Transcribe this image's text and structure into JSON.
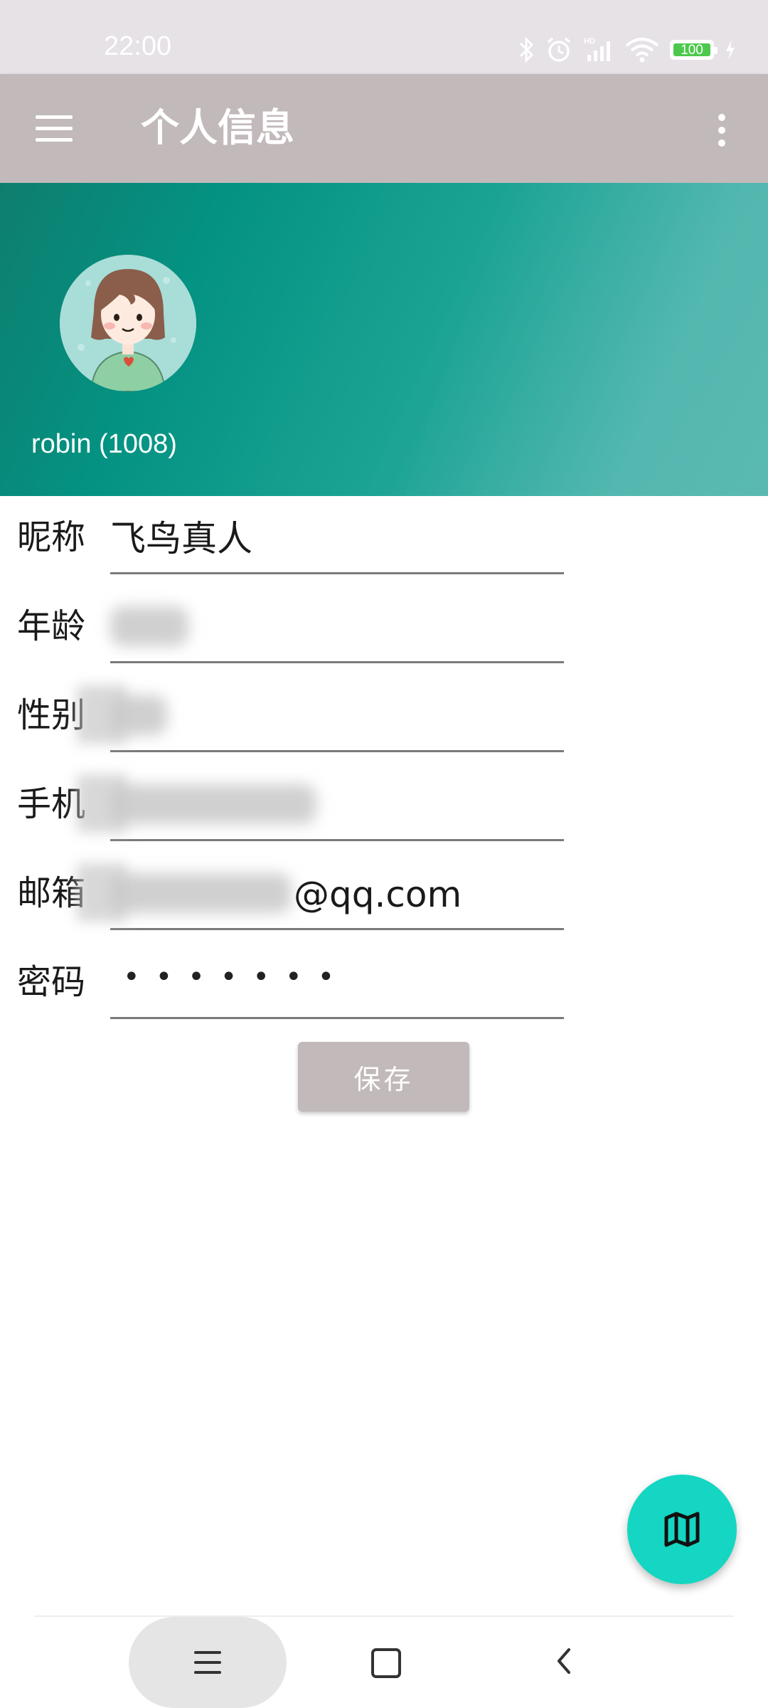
{
  "status_bar": {
    "time": "22:00",
    "icons": [
      "bluetooth-icon",
      "alarm-icon",
      "hd-signal-icon",
      "wifi-icon",
      "battery-icon",
      "charging-icon"
    ],
    "battery": "100"
  },
  "app_bar": {
    "title": "个人信息",
    "menu_icon": "hamburger-menu-icon",
    "more_icon": "more-vert-icon",
    "color": "#c2b9ba"
  },
  "profile": {
    "avatar": "avatar-cartoon-girl",
    "username": "robin (1008)"
  },
  "form": {
    "fields": [
      {
        "label": "昵称",
        "value": "飞鸟真人"
      },
      {
        "label": "年龄",
        "value": ""
      },
      {
        "label": "性别",
        "value": ""
      },
      {
        "label": "手机",
        "value": ""
      },
      {
        "label": "邮箱",
        "value": "@qq.com"
      },
      {
        "label": "密码",
        "value": "•••••••"
      }
    ],
    "save_label": "保存"
  },
  "fab": {
    "icon": "map-icon",
    "color": "#14d6c2"
  },
  "nav_bar": {
    "icons": [
      "menu-icon",
      "home-icon",
      "back-icon"
    ]
  }
}
